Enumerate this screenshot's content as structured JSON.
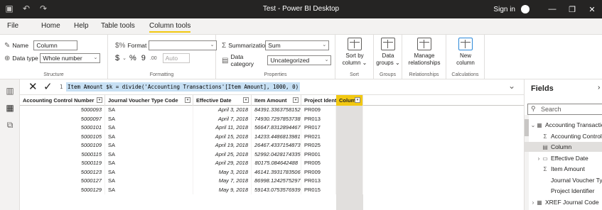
{
  "window": {
    "title": "Test - Power BI Desktop",
    "sign_in": "Sign in",
    "minimize": "—",
    "maximize": "❐",
    "close": "✕"
  },
  "ribbon_tabs": [
    {
      "label": "File",
      "active": false
    },
    {
      "label": "Home",
      "active": false
    },
    {
      "label": "Help",
      "active": false
    },
    {
      "label": "Table tools",
      "active": false
    },
    {
      "label": "Column tools",
      "active": true
    }
  ],
  "structure": {
    "group_label": "Structure",
    "name_label": "Name",
    "name_value": "Column",
    "datatype_label": "Data type",
    "datatype_value": "Whole number"
  },
  "formatting": {
    "group_label": "Formatting",
    "format_label": "Format",
    "format_value": "",
    "currency": "$",
    "percent": "%",
    "comma": "9",
    "decimals": ".00",
    "auto_value": "Auto"
  },
  "properties": {
    "group_label": "Properties",
    "summarization_label": "Summarization",
    "summarization_value": "Sum",
    "category_label": "Data category",
    "category_value": "Uncategorized"
  },
  "sort": {
    "group_label": "Sort",
    "button_line1": "Sort by",
    "button_line2": "column"
  },
  "groups": {
    "group_label": "Groups",
    "button_line1": "Data",
    "button_line2": "groups"
  },
  "relationships": {
    "group_label": "Relationships",
    "button_line1": "Manage",
    "button_line2": "relationships"
  },
  "calculations": {
    "group_label": "Calculations",
    "button_line1": "New",
    "button_line2": "column"
  },
  "formula": {
    "cancel": "✕",
    "commit": "✓",
    "line_number": "1",
    "text": "Item Amount $k = divide('Accounting Transactions'[Item Amount], 1000, 0)"
  },
  "table": {
    "columns": [
      "Accounting Control Number",
      "Journal Voucher Type Code",
      "Effective Date",
      "Item Amount",
      "Project Identifier",
      "Column"
    ],
    "rows": [
      [
        "5000093",
        "SA",
        "April 3, 2018",
        "84391.3363758152",
        "PR009",
        ""
      ],
      [
        "5000097",
        "SA",
        "April 7, 2018",
        "74930.7297853738",
        "PR013",
        ""
      ],
      [
        "5000101",
        "SA",
        "April 11, 2018",
        "56647.8312894467",
        "PR017",
        ""
      ],
      [
        "5000105",
        "SA",
        "April 15, 2018",
        "14233.4486813981",
        "PR021",
        ""
      ],
      [
        "5000109",
        "SA",
        "April 19, 2018",
        "26467.4337154873",
        "PR025",
        ""
      ],
      [
        "5000115",
        "SA",
        "April 25, 2018",
        "52992.0428174335",
        "PR001",
        ""
      ],
      [
        "5000119",
        "SA",
        "April 29, 2018",
        "80175.084642488",
        "PR005",
        ""
      ],
      [
        "5000123",
        "SA",
        "May 3, 2018",
        "46141.3931783506",
        "PR009",
        ""
      ],
      [
        "5000127",
        "SA",
        "May 7, 2018",
        "86998.1242575297",
        "PR013",
        ""
      ],
      [
        "5000129",
        "SA",
        "May 9, 2018",
        "59143.0753576939",
        "PR015",
        ""
      ]
    ]
  },
  "fields_pane": {
    "title": "Fields",
    "close": "›",
    "search_placeholder": "Search",
    "items": [
      {
        "icon": "table-icon",
        "chevron": "v",
        "label": "Accounting Transactions",
        "highlight": false
      },
      {
        "icon": "sigma-icon",
        "chevron": "",
        "label": "Accounting Control Number",
        "highlight": false
      },
      {
        "icon": "calculated-column-icon",
        "chevron": "",
        "label": "Column",
        "highlight": true
      },
      {
        "icon": "calendar-icon",
        "chevron": ">",
        "label": "Effective Date",
        "highlight": false
      },
      {
        "icon": "sigma-icon",
        "chevron": "",
        "label": "Item Amount",
        "highlight": false
      },
      {
        "icon": "",
        "chevron": "",
        "label": "Journal Voucher Type Code",
        "highlight": false
      },
      {
        "icon": "",
        "chevron": "",
        "label": "Project Identifier",
        "highlight": false
      },
      {
        "icon": "table-icon",
        "chevron": ">",
        "label": "XREF Journal Code",
        "highlight": false
      }
    ]
  }
}
